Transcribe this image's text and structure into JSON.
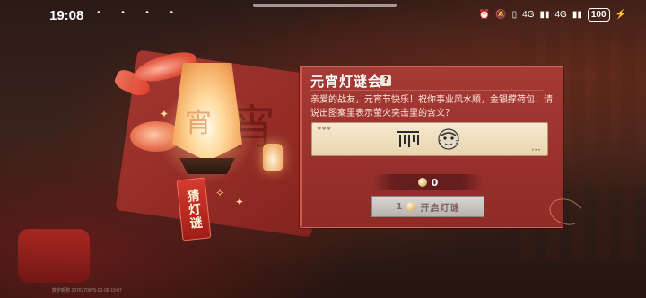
{
  "status_bar": {
    "time": "19:08",
    "dots": "• • • •",
    "signal_4g_a": "4G",
    "signal_4g_b": "4G",
    "battery": "100",
    "icons": [
      "alarm-icon",
      "mute-icon",
      "vibrate-icon",
      "signal-icon",
      "wifi-icon",
      "battery-icon",
      "charging-icon"
    ]
  },
  "lantern": {
    "tag_text": "猜灯谜"
  },
  "dialog": {
    "title": "元宵灯谜会",
    "help": "?",
    "description": "亲爱的战友，元宵节快乐！祝你事业风水顺，金银撑荷包！请说出图案里表示萤火突击里的含义？",
    "riddle_image": "riddle-picture",
    "points_value": "0",
    "open_button_cost": "1",
    "open_button_label": "开启灯谜"
  },
  "watermark": "数字昵称 2876770875-02-08-19:07",
  "colors": {
    "dialog_bg": "#9a322e",
    "accent": "#d35b4d",
    "card_bg": "#f2e4c6",
    "button_bg": "#c8c4bf"
  }
}
